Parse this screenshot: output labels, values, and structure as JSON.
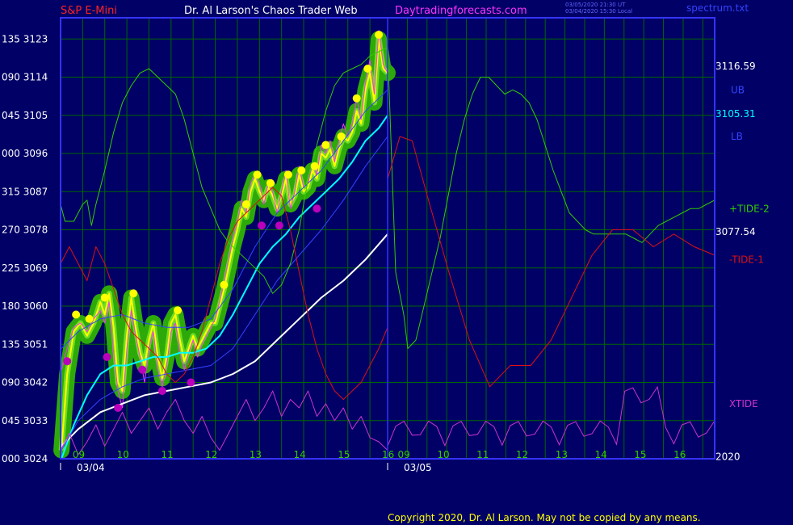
{
  "header": {
    "symbol": "S&P E-Mini",
    "site_title": "Dr. Al Larson's Chaos Trader Web",
    "site_url": "Daytradingforecasts.com",
    "stamp1": "03/05/2020 21:30 UT",
    "stamp2": "03/04/2020 15:30 Local",
    "filename": "spectrum.txt"
  },
  "copyright": "Copyright 2020, Dr. Al Larson. May not be copied by any means.",
  "colors": {
    "background": "#000066",
    "grid": "#006600",
    "frame": "#3333ff",
    "price": "#ffff00",
    "band_glow": "#33bb00",
    "magenta_line": "#ff33ff",
    "ma_cyan": "#00ffff",
    "ma_white": "#ffffff",
    "ma_blue": "#3344ff",
    "tide_plus": "#33cc00",
    "tide_minus": "#dd1111",
    "xtide": "#cc33cc",
    "high_dot": "#ffff00",
    "low_dot": "#bb00bb"
  },
  "chart_data": {
    "type": "line",
    "title": "S&P E-Mini",
    "xlabel": "",
    "ylabel": "",
    "ylim": [
      3024,
      3128
    ],
    "xlim": [
      8.6,
      17.0
    ],
    "grid": true,
    "y_ticks": [
      {
        "value": 3024,
        "label": "3024",
        "prefix": "000"
      },
      {
        "value": 3033,
        "label": "3033",
        "prefix": "045"
      },
      {
        "value": 3042,
        "label": "3042",
        "prefix": "090"
      },
      {
        "value": 3051,
        "label": "3051",
        "prefix": "135"
      },
      {
        "value": 3060,
        "label": "3060",
        "prefix": "180"
      },
      {
        "value": 3069,
        "label": "3069",
        "prefix": "225"
      },
      {
        "value": 3078,
        "label": "3078",
        "prefix": "270"
      },
      {
        "value": 3087,
        "label": "3087",
        "prefix": "315"
      },
      {
        "value": 3096,
        "label": "3096",
        "prefix": "000"
      },
      {
        "value": 3105,
        "label": "3105",
        "prefix": "045"
      },
      {
        "value": 3114,
        "label": "3114",
        "prefix": "090"
      },
      {
        "value": 3123,
        "label": "3123",
        "prefix": "135"
      }
    ],
    "x_ticks": [
      {
        "value": 9.0,
        "label": "09"
      },
      {
        "value": 10.0,
        "label": "10"
      },
      {
        "value": 11.0,
        "label": "11"
      },
      {
        "value": 12.0,
        "label": "12"
      },
      {
        "value": 13.0,
        "label": "13"
      },
      {
        "value": 14.0,
        "label": "14"
      },
      {
        "value": 15.0,
        "label": "15"
      },
      {
        "value": 16.0,
        "label": "16"
      },
      {
        "value": 9.0,
        "label": "09",
        "day": 2
      },
      {
        "value": 10.0,
        "label": "10",
        "day": 2
      },
      {
        "value": 11.0,
        "label": "11",
        "day": 2
      },
      {
        "value": 12.0,
        "label": "12",
        "day": 2
      },
      {
        "value": 13.0,
        "label": "13",
        "day": 2
      },
      {
        "value": 14.0,
        "label": "14",
        "day": 2
      },
      {
        "value": 15.0,
        "label": "15",
        "day": 2
      },
      {
        "value": 16.0,
        "label": "16",
        "day": 2
      }
    ],
    "dates": [
      {
        "label": "03/04",
        "x": 8.6
      },
      {
        "label": "03/05",
        "x": 16.5
      }
    ],
    "right_labels": [
      {
        "text": "3116.59",
        "y": 3116.6,
        "color": "#ffffff"
      },
      {
        "text": "UB",
        "y": 3111.0,
        "color": "#3344ff"
      },
      {
        "text": "3105.31",
        "y": 3105.3,
        "color": "#00ffff"
      },
      {
        "text": "LB",
        "y": 3100.0,
        "color": "#3344ff"
      },
      {
        "text": "+TIDE-2",
        "y": 3083.0,
        "color": "#33cc00"
      },
      {
        "text": "3077.54",
        "y": 3077.5,
        "color": "#ffffff"
      },
      {
        "text": "-TIDE-1",
        "y": 3071.0,
        "color": "#dd1111"
      },
      {
        "text": "XTIDE",
        "y": 3037.0,
        "color": "#cc33cc"
      },
      {
        "text": "2020",
        "y": 3024.5,
        "color": "#ffffff"
      }
    ],
    "series": [
      {
        "name": "Price",
        "color": "#ffff00",
        "x": [
          8.62,
          8.75,
          8.9,
          9.05,
          9.2,
          9.35,
          9.5,
          9.6,
          9.7,
          9.8,
          9.9,
          10.0,
          10.1,
          10.2,
          10.3,
          10.4,
          10.5,
          10.6,
          10.7,
          10.8,
          10.9,
          11.0,
          11.1,
          11.2,
          11.3,
          11.4,
          11.5,
          11.6,
          11.7,
          11.8,
          11.9,
          12.0,
          12.1,
          12.2,
          12.3,
          12.4,
          12.5,
          12.6,
          12.7,
          12.8,
          12.9,
          13.0,
          13.1,
          13.2,
          13.3,
          13.4,
          13.5,
          13.6,
          13.7,
          13.8,
          13.9,
          14.0,
          14.1,
          14.2,
          14.3,
          14.4,
          14.5,
          14.6,
          14.7,
          14.8,
          14.9,
          15.0,
          15.1,
          15.2,
          15.3,
          15.4,
          15.5,
          15.6,
          15.7,
          15.8,
          15.9,
          16.0
        ],
        "y": [
          3026,
          3044,
          3054,
          3056,
          3053,
          3056,
          3061,
          3058,
          3063,
          3055,
          3042,
          3040,
          3053,
          3062,
          3055,
          3049,
          3046,
          3052,
          3056,
          3048,
          3043,
          3048,
          3056,
          3058,
          3052,
          3047,
          3050,
          3053,
          3050,
          3052,
          3054,
          3056,
          3056,
          3060,
          3064,
          3069,
          3074,
          3078,
          3083,
          3081,
          3087,
          3090,
          3087,
          3085,
          3088,
          3086,
          3083,
          3086,
          3090,
          3084,
          3086,
          3091,
          3087,
          3088,
          3092,
          3090,
          3096,
          3095,
          3097,
          3093,
          3097,
          3100,
          3099,
          3101,
          3106,
          3103,
          3111,
          3115,
          3108,
          3123,
          3116,
          3115
        ]
      },
      {
        "name": "Magenta",
        "color": "#ff33ff",
        "x": [
          8.62,
          8.75,
          8.9,
          9.05,
          9.2,
          9.35,
          9.5,
          9.6,
          9.7,
          9.8,
          9.9,
          10.0,
          10.1,
          10.2,
          10.3,
          10.4,
          10.5,
          10.6,
          10.7,
          10.8,
          10.9,
          11.0,
          11.1,
          11.2,
          11.3,
          11.4,
          11.5,
          11.6,
          11.7,
          11.8,
          11.9,
          12.0,
          12.1,
          12.2,
          12.3,
          12.4,
          12.5,
          12.6,
          12.7,
          12.8,
          12.9,
          13.0,
          13.1,
          13.2,
          13.3,
          13.4,
          13.5,
          13.6,
          13.7,
          13.8,
          13.9,
          14.0,
          14.1,
          14.2,
          14.3,
          14.4,
          14.5,
          14.6,
          14.7,
          14.8,
          14.9,
          15.0,
          15.1,
          15.2,
          15.3,
          15.4,
          15.5,
          15.6,
          15.7,
          15.8,
          15.9,
          16.0
        ],
        "y": [
          3045,
          3050,
          3055,
          3056,
          3054,
          3057,
          3059,
          3056,
          3061,
          3049,
          3040,
          3036,
          3050,
          3059,
          3053,
          3048,
          3042,
          3050,
          3054,
          3045,
          3041,
          3046,
          3054,
          3056,
          3049,
          3045,
          3049,
          3052,
          3048,
          3051,
          3053,
          3055,
          3057,
          3061,
          3066,
          3071,
          3076,
          3080,
          3085,
          3082,
          3089,
          3091,
          3089,
          3084,
          3089,
          3087,
          3082,
          3087,
          3092,
          3083,
          3087,
          3093,
          3088,
          3089,
          3094,
          3091,
          3098,
          3096,
          3099,
          3094,
          3099,
          3103,
          3100,
          3103,
          3109,
          3104,
          3113,
          3118,
          3110,
          3125,
          3117,
          3115
        ]
      },
      {
        "name": "MA-cyan",
        "color": "#00ffff",
        "x": [
          8.62,
          8.9,
          9.2,
          9.5,
          9.8,
          10.1,
          10.4,
          10.7,
          11.0,
          11.3,
          11.6,
          11.9,
          12.2,
          12.5,
          12.8,
          13.1,
          13.4,
          13.7,
          14.0,
          14.3,
          14.6,
          14.9,
          15.2,
          15.5,
          15.8,
          16.0
        ],
        "y": [
          3024,
          3032,
          3039,
          3044,
          3046,
          3046,
          3047,
          3048,
          3048,
          3049,
          3049,
          3050,
          3053,
          3058,
          3064,
          3070,
          3074,
          3077,
          3081,
          3084,
          3087,
          3090,
          3094,
          3099,
          3102,
          3105
        ]
      },
      {
        "name": "MA-white",
        "color": "#ffffff",
        "x": [
          8.62,
          9.0,
          9.5,
          10.0,
          10.5,
          11.0,
          11.5,
          12.0,
          12.5,
          13.0,
          13.5,
          14.0,
          14.5,
          15.0,
          15.5,
          16.0
        ],
        "y": [
          3027,
          3031,
          3035,
          3037,
          3039,
          3040,
          3041,
          3042,
          3044,
          3047,
          3052,
          3057,
          3062,
          3066,
          3071,
          3077
        ]
      },
      {
        "name": "UB",
        "color": "#3344ff",
        "x": [
          8.62,
          9.0,
          9.5,
          10.0,
          10.5,
          11.0,
          11.5,
          12.0,
          12.5,
          13.0,
          13.5,
          14.0,
          14.5,
          15.0,
          15.5,
          16.0
        ],
        "y": [
          3050,
          3054,
          3057,
          3058,
          3056,
          3055,
          3055,
          3057,
          3064,
          3074,
          3082,
          3087,
          3092,
          3099,
          3106,
          3111
        ]
      },
      {
        "name": "LB",
        "color": "#3344ff",
        "x": [
          8.62,
          9.0,
          9.5,
          10.0,
          10.5,
          11.0,
          11.5,
          12.0,
          12.5,
          13.0,
          13.5,
          14.0,
          14.5,
          15.0,
          15.5,
          16.0
        ],
        "y": [
          3026,
          3033,
          3038,
          3041,
          3043,
          3044,
          3045,
          3046,
          3050,
          3058,
          3066,
          3072,
          3078,
          3085,
          3093,
          3100
        ]
      },
      {
        "name": "+TIDE-2",
        "color": "#33cc00",
        "x": [
          8.6,
          8.7,
          8.9,
          9.1,
          9.2,
          9.3,
          9.4,
          9.6,
          9.8,
          10.0,
          10.2,
          10.4,
          10.6,
          10.8,
          11.0,
          11.2,
          11.4,
          11.6,
          11.8,
          12.0,
          12.2,
          12.4,
          12.6,
          12.8,
          13.0,
          13.2,
          13.4,
          13.6,
          13.8,
          14.0,
          14.2,
          14.4,
          14.6,
          14.8,
          15.0,
          15.2,
          15.4,
          15.6,
          15.8,
          16.0,
          16.2,
          16.4,
          16.5,
          16.7,
          16.9,
          17.1,
          17.3,
          17.5,
          17.7,
          17.9,
          18.1,
          18.3,
          18.5,
          18.7,
          18.9,
          19.1,
          19.3,
          19.5,
          19.7,
          19.9,
          20.1,
          20.3,
          20.5,
          20.7,
          20.9,
          21.1,
          21.3,
          21.5,
          21.7,
          21.9,
          22.1,
          22.3,
          22.5,
          22.7,
          22.9,
          23.1,
          23.3,
          23.5,
          23.7,
          23.9,
          24.1
        ],
        "y": [
          3084,
          3080,
          3080,
          3084,
          3085,
          3079,
          3084,
          3092,
          3101,
          3108,
          3112,
          3115,
          3116,
          3114,
          3112,
          3110,
          3104,
          3096,
          3088,
          3083,
          3078,
          3075,
          3073,
          3071,
          3069,
          3067,
          3063,
          3065,
          3070,
          3078,
          3090,
          3098,
          3106,
          3112,
          3115,
          3116,
          3117,
          3119,
          3120,
          3121,
          3068,
          3058,
          3050,
          3052,
          3060,
          3068,
          3076,
          3086,
          3096,
          3104,
          3110,
          3114,
          3114,
          3112,
          3110,
          3111,
          3110,
          3108,
          3104,
          3098,
          3092,
          3087,
          3082,
          3080,
          3078,
          3077,
          3077,
          3077,
          3077,
          3077,
          3076,
          3075,
          3077,
          3079,
          3080,
          3081,
          3082,
          3083,
          3083,
          3084,
          3085
        ],
        "note_day2_offset": true
      },
      {
        "name": "-TIDE-1",
        "color": "#dd1111",
        "x": [
          8.6,
          8.8,
          9.0,
          9.2,
          9.4,
          9.6,
          9.8,
          10.0,
          10.2,
          10.4,
          10.6,
          10.8,
          11.0,
          11.2,
          11.4,
          11.6,
          11.8,
          12.0,
          12.2,
          12.4,
          12.6,
          12.8,
          13.0,
          13.2,
          13.4,
          13.6,
          13.8,
          14.0,
          14.2,
          14.4,
          14.6,
          14.8,
          15.0,
          15.2,
          15.4,
          15.6,
          15.8,
          16.0
        ],
        "y": [
          3070,
          3074,
          3070,
          3066,
          3074,
          3070,
          3064,
          3058,
          3054,
          3052,
          3050,
          3048,
          3044,
          3042,
          3044,
          3048,
          3054,
          3062,
          3070,
          3076,
          3080,
          3082,
          3084,
          3086,
          3088,
          3086,
          3078,
          3068,
          3058,
          3050,
          3044,
          3040,
          3038,
          3040,
          3042,
          3046,
          3050,
          3055
        ]
      },
      {
        "name": "XTIDE",
        "color": "#cc33cc",
        "x": [
          8.6,
          8.8,
          9.0,
          9.2,
          9.4,
          9.6,
          9.8,
          10.0,
          10.2,
          10.4,
          10.6,
          10.8,
          11.0,
          11.2,
          11.4,
          11.6,
          11.8,
          12.0,
          12.2,
          12.4,
          12.6,
          12.8,
          13.0,
          13.2,
          13.4,
          13.6,
          13.8,
          14.0,
          14.2,
          14.4,
          14.6,
          14.8,
          15.0,
          15.2,
          15.4,
          15.6,
          15.8,
          16.0
        ],
        "y": [
          3026,
          3030,
          3025,
          3028,
          3032,
          3027,
          3031,
          3035,
          3030,
          3033,
          3036,
          3031,
          3035,
          3038,
          3033,
          3030,
          3034,
          3029,
          3026,
          3030,
          3034,
          3038,
          3033,
          3036,
          3040,
          3034,
          3038,
          3036,
          3040,
          3034,
          3037,
          3033,
          3036,
          3031,
          3034,
          3029,
          3028,
          3026
        ]
      }
    ],
    "high_dots": [
      {
        "x": 8.95,
        "y": 3058
      },
      {
        "x": 9.25,
        "y": 3057
      },
      {
        "x": 9.6,
        "y": 3062
      },
      {
        "x": 10.25,
        "y": 3063
      },
      {
        "x": 11.25,
        "y": 3059
      },
      {
        "x": 12.3,
        "y": 3065
      },
      {
        "x": 12.8,
        "y": 3084
      },
      {
        "x": 13.05,
        "y": 3091
      },
      {
        "x": 13.35,
        "y": 3089
      },
      {
        "x": 13.75,
        "y": 3091
      },
      {
        "x": 14.05,
        "y": 3092
      },
      {
        "x": 14.35,
        "y": 3093
      },
      {
        "x": 14.6,
        "y": 3098
      },
      {
        "x": 14.95,
        "y": 3100
      },
      {
        "x": 15.3,
        "y": 3109
      },
      {
        "x": 15.55,
        "y": 3116
      },
      {
        "x": 15.8,
        "y": 3124
      }
    ],
    "low_dots": [
      {
        "x": 8.75,
        "y": 3047
      },
      {
        "x": 9.65,
        "y": 3048
      },
      {
        "x": 9.9,
        "y": 3036
      },
      {
        "x": 10.45,
        "y": 3045
      },
      {
        "x": 10.9,
        "y": 3040
      },
      {
        "x": 11.55,
        "y": 3042
      },
      {
        "x": 13.15,
        "y": 3079
      },
      {
        "x": 13.55,
        "y": 3079
      },
      {
        "x": 14.4,
        "y": 3083
      }
    ]
  }
}
